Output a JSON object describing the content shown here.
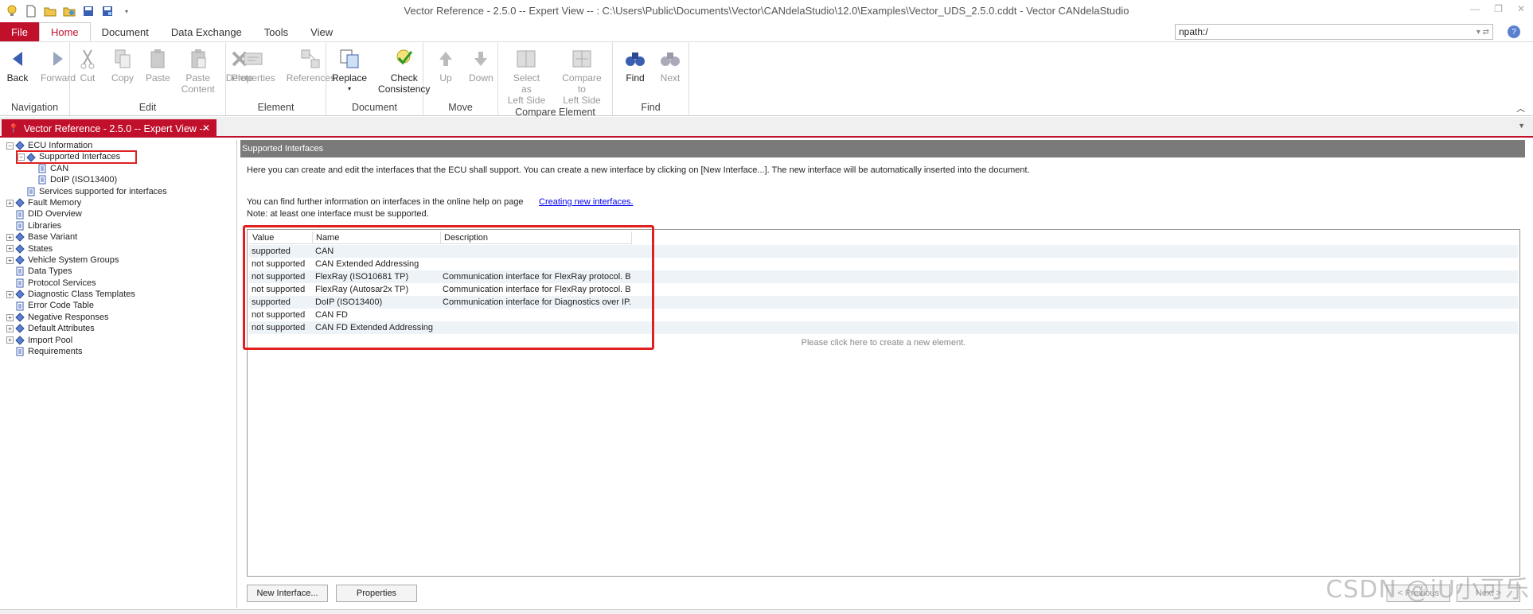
{
  "window": {
    "title": "Vector Reference - 2.5.0 -- Expert View -- : C:\\Users\\Public\\Documents\\Vector\\CANdelaStudio\\12.0\\Examples\\Vector_UDS_2.5.0.cddt - Vector CANdelaStudio"
  },
  "menu": {
    "tabs": [
      "File",
      "Home",
      "Document",
      "Data Exchange",
      "Tools",
      "View"
    ],
    "npath_value": "npath:/"
  },
  "ribbon": {
    "groups": [
      {
        "label": "Navigation",
        "buttons": [
          [
            "Back",
            ""
          ],
          [
            "Forward",
            ""
          ]
        ]
      },
      {
        "label": "Edit",
        "buttons": [
          [
            "Cut",
            ""
          ],
          [
            "Copy",
            ""
          ],
          [
            "Paste",
            ""
          ],
          [
            "Paste",
            "Content"
          ],
          [
            "Delete",
            ""
          ]
        ]
      },
      {
        "label": "Element",
        "buttons": [
          [
            "Properties",
            ""
          ],
          [
            "References",
            ""
          ]
        ]
      },
      {
        "label": "Document",
        "buttons": [
          [
            "Replace",
            ""
          ],
          [
            "Check",
            "Consistency"
          ]
        ]
      },
      {
        "label": "Move",
        "buttons": [
          [
            "Up",
            ""
          ],
          [
            "Down",
            ""
          ]
        ]
      },
      {
        "label": "Compare Element",
        "buttons": [
          [
            "Select as",
            "Left Side"
          ],
          [
            "Compare to",
            "Left Side"
          ]
        ]
      },
      {
        "label": "Find",
        "buttons": [
          [
            "Find",
            ""
          ],
          [
            "Next",
            ""
          ]
        ]
      }
    ]
  },
  "doc_tab": {
    "label": "Vector Reference - 2.5.0 -- Expert View --",
    "close": "✕"
  },
  "tree": {
    "nodes": [
      {
        "label": "ECU Information",
        "level": 0,
        "expander": "−"
      },
      {
        "label": "Supported Interfaces",
        "level": 1,
        "expander": "−"
      },
      {
        "label": "CAN",
        "level": 2,
        "expander": ""
      },
      {
        "label": "DoIP (ISO13400)",
        "level": 2,
        "expander": ""
      },
      {
        "label": "Services supported for interfaces",
        "level": 1,
        "expander": ""
      },
      {
        "label": "Fault Memory",
        "level": 0,
        "expander": "+"
      },
      {
        "label": "DID Overview",
        "level": 0,
        "expander": ""
      },
      {
        "label": "Libraries",
        "level": 0,
        "expander": ""
      },
      {
        "label": "Base Variant",
        "level": 0,
        "expander": "+"
      },
      {
        "label": "States",
        "level": 0,
        "expander": "+"
      },
      {
        "label": "Vehicle System Groups",
        "level": 0,
        "expander": "+"
      },
      {
        "label": "Data Types",
        "level": 0,
        "expander": ""
      },
      {
        "label": "Protocol Services",
        "level": 0,
        "expander": ""
      },
      {
        "label": "Diagnostic Class Templates",
        "level": 0,
        "expander": "+"
      },
      {
        "label": "Error Code Table",
        "level": 0,
        "expander": ""
      },
      {
        "label": "Negative Responses",
        "level": 0,
        "expander": "+"
      },
      {
        "label": "Default Attributes",
        "level": 0,
        "expander": "+"
      },
      {
        "label": "Import Pool",
        "level": 0,
        "expander": "+"
      },
      {
        "label": "Requirements",
        "level": 0,
        "expander": ""
      }
    ]
  },
  "content": {
    "header": "Supported Interfaces",
    "intro": "Here you can create and edit the interfaces that the ECU shall support. You can create a new interface by clicking on [New Interface...]. The new interface will be automatically inserted into the document.",
    "help_line": "You can find further information on interfaces in the online help on page",
    "help_link": "Creating new interfaces.",
    "note": "Note: at least one interface must be supported.",
    "columns": [
      "Value",
      "Name",
      "Description"
    ],
    "rows": [
      [
        "supported",
        "CAN",
        ""
      ],
      [
        "not supported",
        "CAN Extended Addressing",
        ""
      ],
      [
        "not supported",
        "FlexRay (ISO10681 TP)",
        "Communication interface for FlexRay protocol. B..."
      ],
      [
        "not supported",
        "FlexRay (Autosar2x TP)",
        "Communication interface for FlexRay protocol. B..."
      ],
      [
        "supported",
        "DoIP (ISO13400)",
        "Communication interface for Diagnostics over IP..."
      ],
      [
        "not supported",
        "CAN FD",
        ""
      ],
      [
        "not supported",
        "CAN FD Extended Addressing",
        ""
      ]
    ],
    "hint": "Please click here to create a new element.",
    "buttons": {
      "new_interface": "New Interface...",
      "properties": "Properties",
      "previous": "< Previous",
      "next": "Next >"
    }
  },
  "watermark": "CSDN @iU小可乐"
}
